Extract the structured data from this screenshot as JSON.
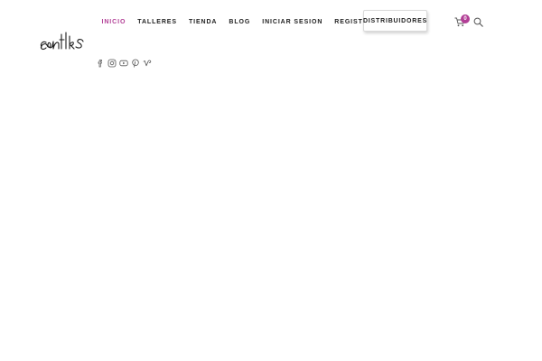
{
  "brand": {
    "logo_text": "cantik"
  },
  "nav": {
    "items": [
      {
        "label": "INICIO",
        "active": true
      },
      {
        "label": "TALLERES",
        "active": false
      },
      {
        "label": "TIENDA",
        "active": false
      },
      {
        "label": "BLOG",
        "active": false
      },
      {
        "label": "INICIAR SESION",
        "active": false
      },
      {
        "label": "REGISTRATE",
        "active": false
      }
    ],
    "distributors_label": "DISTRIBUIDORES"
  },
  "cart": {
    "count": "0",
    "icon": "cart-icon"
  },
  "search": {
    "icon": "search-icon"
  },
  "social": {
    "icons": [
      "facebook-icon",
      "instagram-icon",
      "youtube-icon",
      "pinterest-icon",
      "vimeo-icon"
    ]
  },
  "colors": {
    "accent": "#b23f96",
    "text": "#222222",
    "background": "#ffffff"
  }
}
